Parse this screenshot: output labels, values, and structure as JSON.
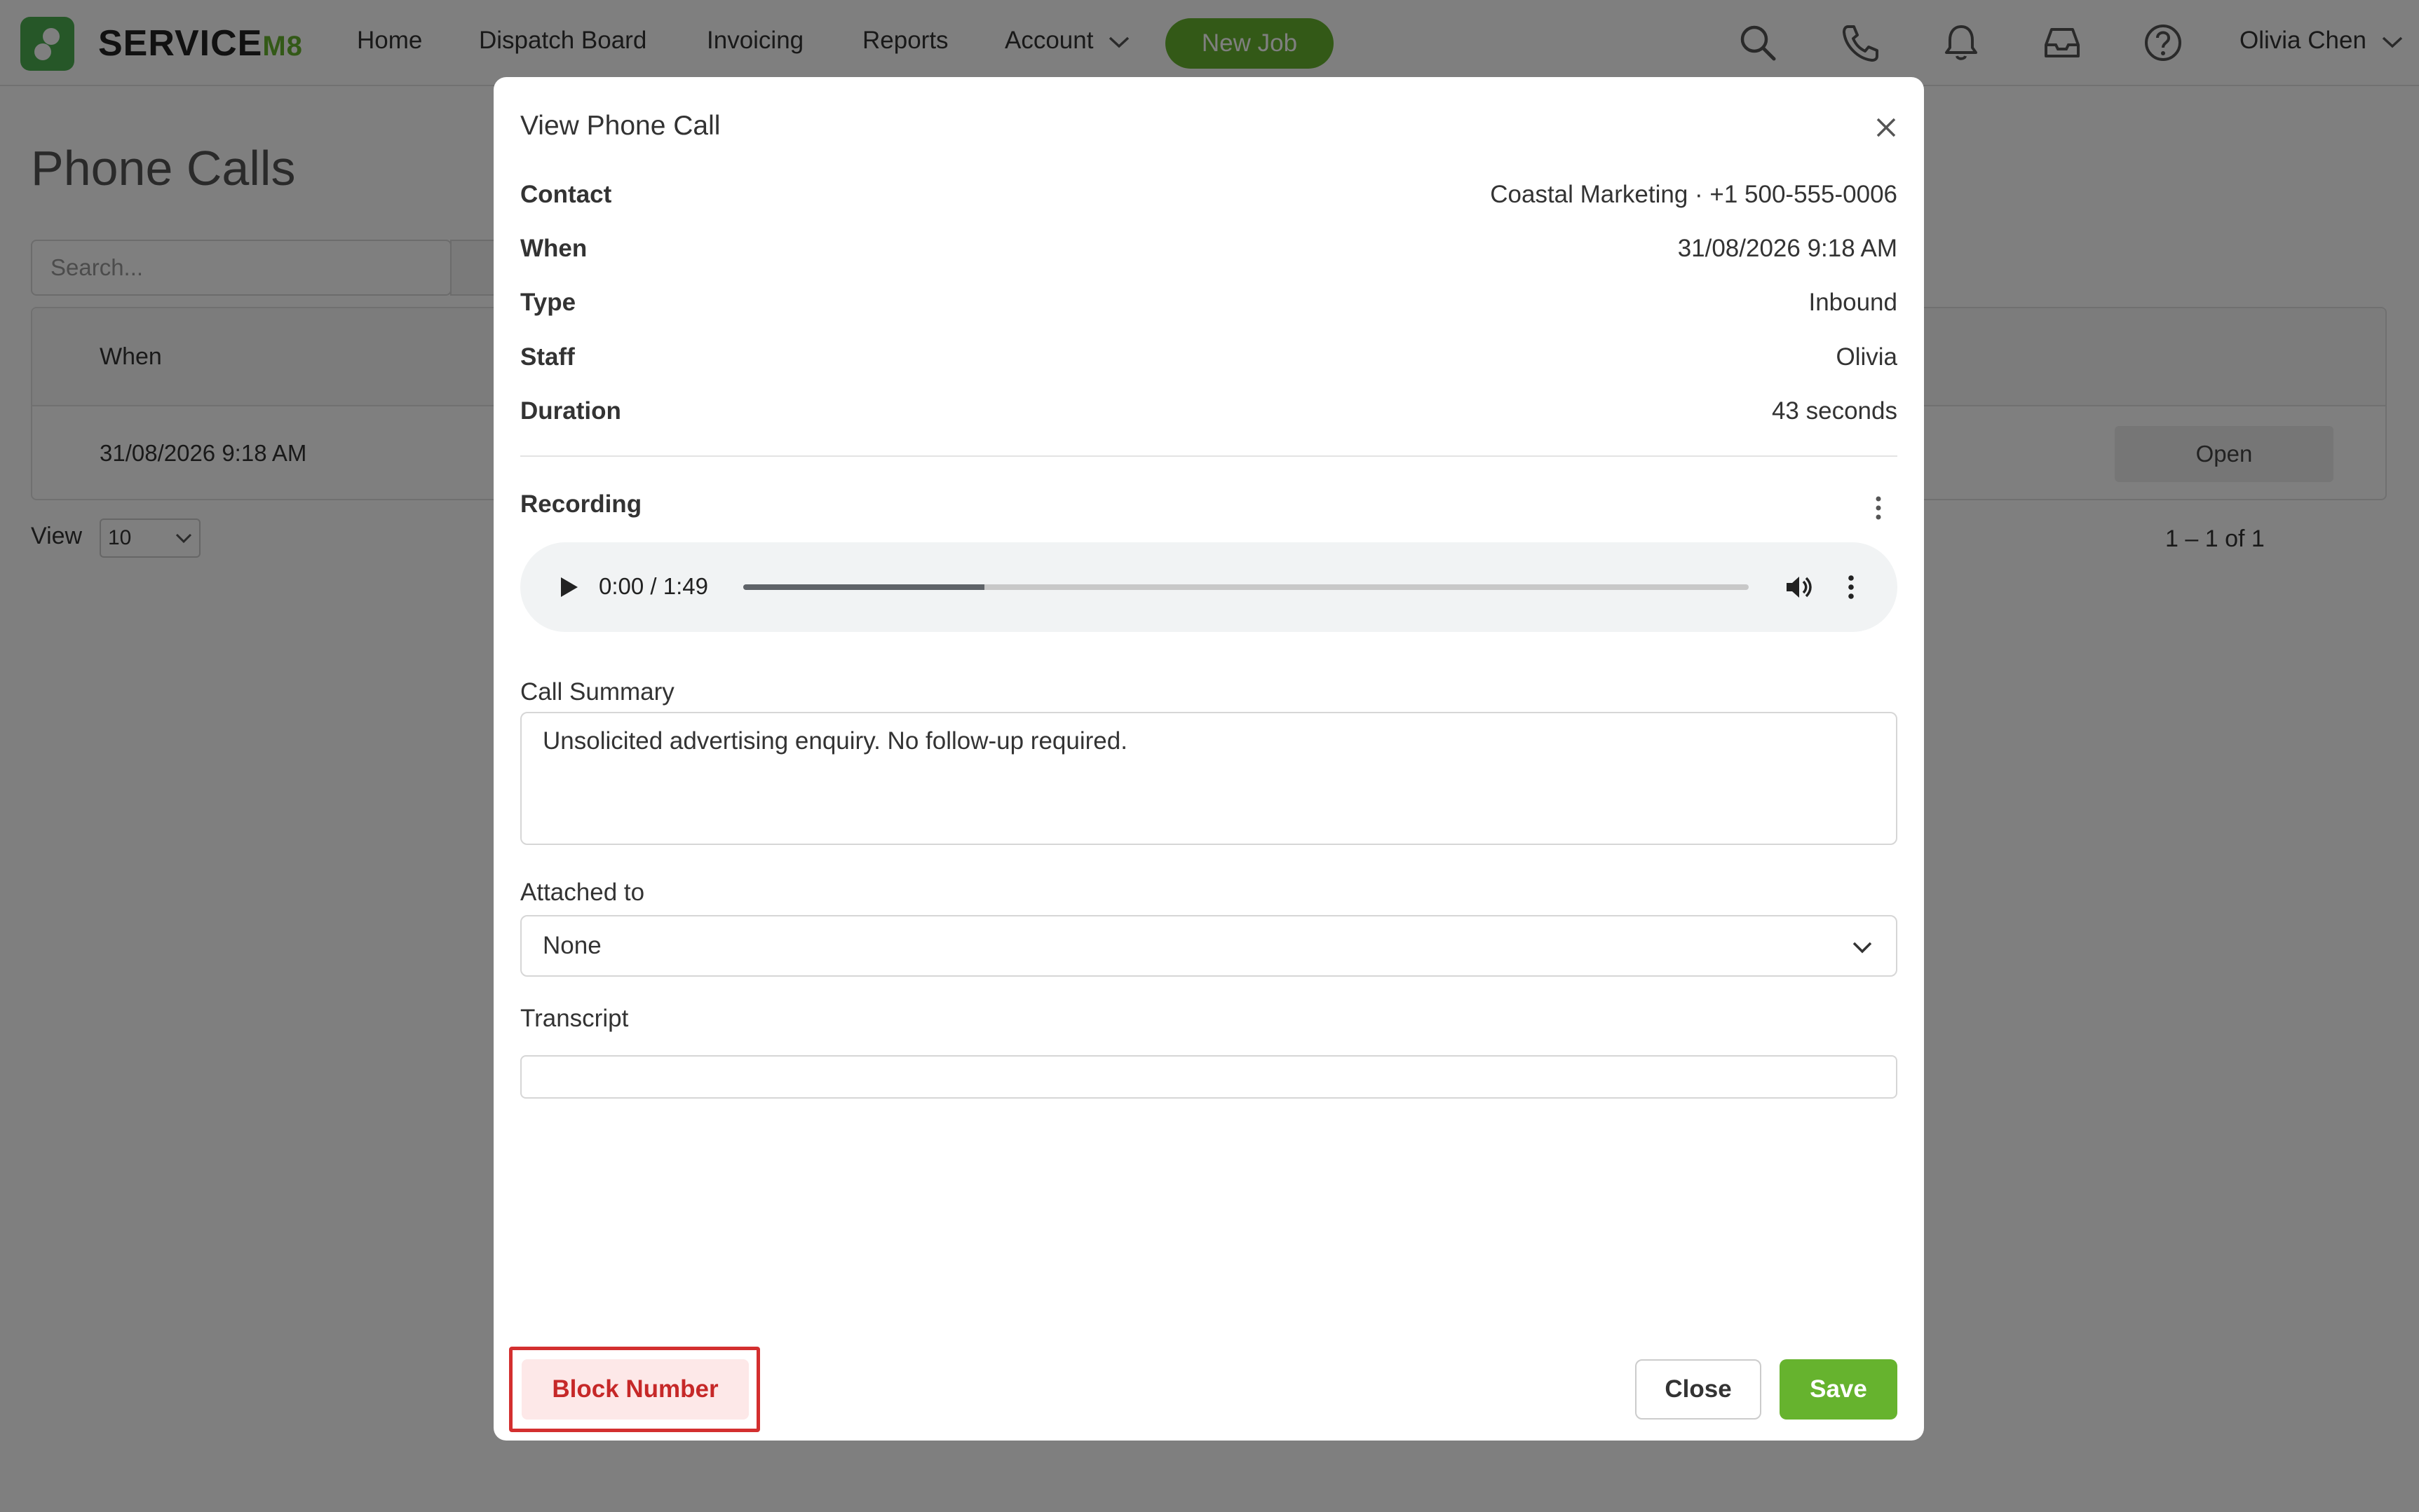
{
  "app": {
    "brand": "SERVICE",
    "brand_suffix": "M8"
  },
  "nav": {
    "items": [
      {
        "label": "Home"
      },
      {
        "label": "Dispatch Board"
      },
      {
        "label": "Invoicing"
      },
      {
        "label": "Reports"
      },
      {
        "label": "Account"
      }
    ],
    "new_job": "New Job",
    "user": "Olivia Chen"
  },
  "background": {
    "title": "Phone Calls",
    "search_placeholder": "Search...",
    "column_when": "When",
    "row_when": "31/08/2026 9:18 AM",
    "open_label": "Open",
    "view_label": "View",
    "view_value": "10",
    "pager": "1 – 1 of 1"
  },
  "modal": {
    "title": "View Phone Call",
    "fields": [
      {
        "label": "Contact",
        "value": "Coastal Marketing · +1 500-555-0006"
      },
      {
        "label": "When",
        "value": "31/08/2026 9:18 AM"
      },
      {
        "label": "Type",
        "value": "Inbound"
      },
      {
        "label": "Staff",
        "value": "Olivia"
      },
      {
        "label": "Duration",
        "value": "43 seconds"
      }
    ],
    "recording_label": "Recording",
    "audio": {
      "time": "0:00 / 1:49",
      "progress": 0.24
    },
    "summary_label": "Call Summary",
    "summary_value": "Unsolicited advertising enquiry. No follow-up required.",
    "attached_label": "Attached to",
    "attached_value": "None",
    "transcript_label": "Transcript",
    "block_label": "Block Number",
    "close_label": "Close",
    "save_label": "Save"
  },
  "colors": {
    "brand_green": "#66b32e",
    "danger_red": "#c62828"
  }
}
